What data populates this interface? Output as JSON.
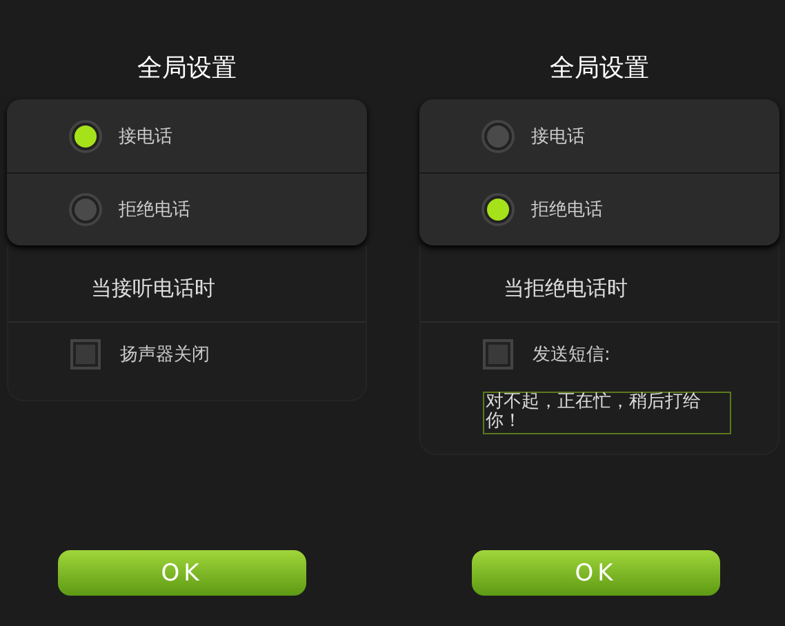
{
  "panels": [
    {
      "title": "全局设置",
      "options": [
        {
          "label": "接电话",
          "selected": true
        },
        {
          "label": "拒绝电话",
          "selected": false
        }
      ],
      "section_title": "当接听电话时",
      "checkbox": {
        "label": "扬声器关闭",
        "checked": false
      },
      "ok_label": "OK"
    },
    {
      "title": "全局设置",
      "options": [
        {
          "label": "接电话",
          "selected": false
        },
        {
          "label": "拒绝电话",
          "selected": true
        }
      ],
      "section_title": "当拒绝电话时",
      "checkbox": {
        "label": "发送短信:",
        "checked": false
      },
      "message": {
        "value": "对不起，正在忙，稍后打给你！"
      },
      "ok_label": "OK"
    }
  ]
}
